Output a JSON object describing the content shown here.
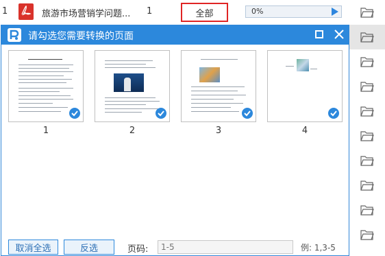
{
  "file_row": {
    "index": "1",
    "name": "旅游市场营销学问题...",
    "pages": "1",
    "range": "全部",
    "progress_text": "0%",
    "progress": 0
  },
  "dialog": {
    "title": "请勾选您需要转换的页面",
    "thumbnails": [
      {
        "label": "1",
        "checked": true
      },
      {
        "label": "2",
        "checked": true
      },
      {
        "label": "3",
        "checked": true
      },
      {
        "label": "4",
        "checked": true
      }
    ],
    "buttons": {
      "deselect_all": "取消全选",
      "invert": "反选"
    },
    "page_label": "页码:",
    "page_input_placeholder": "1-5",
    "example": "例: 1,3-5"
  },
  "colors": {
    "accent": "#2c88dc",
    "highlight_border": "#e02424"
  },
  "icons": [
    "pdf-icon",
    "folder-icon",
    "app-logo-icon",
    "maximize-icon",
    "close-icon",
    "check-icon",
    "play-icon"
  ]
}
